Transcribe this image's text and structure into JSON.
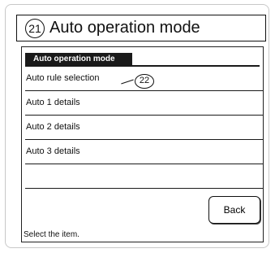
{
  "header": {
    "number": "21",
    "title": "Auto operation mode"
  },
  "screen": {
    "tab_label": "Auto operation mode",
    "menu": [
      {
        "label": "Auto rule selection"
      },
      {
        "label": "Auto 1 details"
      },
      {
        "label": "Auto 2 details"
      },
      {
        "label": "Auto 3 details"
      }
    ],
    "callout_number": "22",
    "back_label": "Back",
    "status_text": "Select the item."
  }
}
